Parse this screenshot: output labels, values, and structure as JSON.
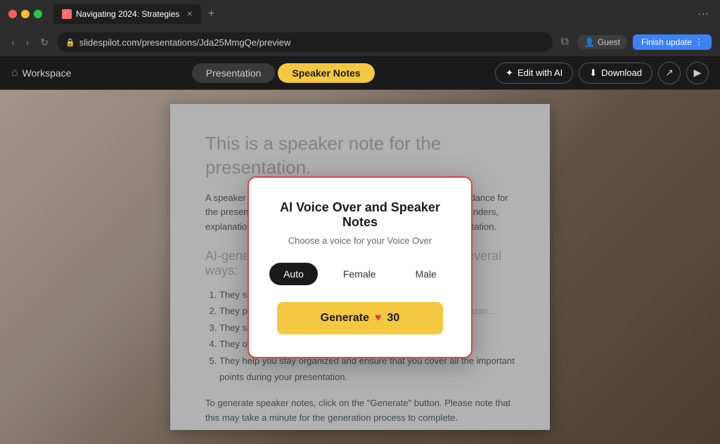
{
  "browser": {
    "tab_title": "Navigating 2024: Strategies",
    "url": "slidespilot.com/presentations/Jda25MmgQe/preview",
    "guest_label": "Guest",
    "finish_update_label": "Finish update"
  },
  "toolbar": {
    "workspace_label": "Workspace",
    "tab_presentation": "Presentation",
    "tab_speaker_notes": "Speaker Notes",
    "edit_ai_label": "Edit with AI",
    "download_label": "Download"
  },
  "document": {
    "title": "This is a speaker note for the presentation.",
    "intro": "A speaker note is a text that provides additional information or guidance for the presenter during a presentation. It can include key points, reminders, explanations, or instructions to enhance the delivery of the presentation.",
    "section_title": "AI-generated speaker notes can be helpful in several ways:",
    "list_items": [
      "They summ... ...research and helping yo...",
      "They provi... ...e generated PowerPoint... ...ng a deeper understan...",
      "They save... ...your presenta...",
      "They offer... ...rity of your presenta...",
      "They help you stay organized and ensure that you cover all the important points during your presentation."
    ],
    "footer": "To generate speaker notes, click on the \"Generate\" button. Please note that this may take a minute for the generation process to complete."
  },
  "modal": {
    "title": "AI Voice Over and Speaker Notes",
    "subtitle": "Choose a voice for your Voice Over",
    "voice_options": [
      {
        "label": "Auto",
        "selected": true
      },
      {
        "label": "Female",
        "selected": false
      },
      {
        "label": "Male",
        "selected": false
      }
    ],
    "generate_label": "Generate",
    "credits": "30"
  }
}
